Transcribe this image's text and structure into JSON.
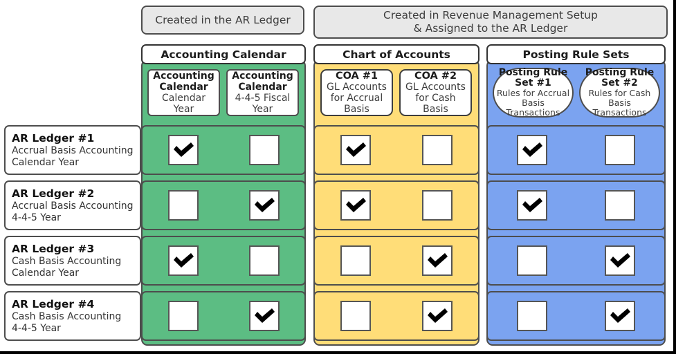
{
  "banners": [
    {
      "id": "created-ar-ledger",
      "text": "Created in the AR Ledger"
    },
    {
      "id": "created-rev-mgmt",
      "text": "Created in Revenue Management Setup\n& Assigned to the AR Ledger"
    }
  ],
  "columns": [
    {
      "id": "accounting-calendar",
      "header": "Accounting Calendar",
      "color": "#5cbd83",
      "cards": [
        {
          "title": "Accounting\nCalendar",
          "subtitle": "Calendar Year"
        },
        {
          "title": "Accounting\nCalendar",
          "subtitle": "4-4-5 Fiscal\nYear"
        }
      ]
    },
    {
      "id": "chart-of-accounts",
      "header": "Chart of Accounts",
      "color": "#ffdd78",
      "cards": [
        {
          "title": "COA #1",
          "subtitle": "GL Accounts\nfor Accrual\nBasis"
        },
        {
          "title": "COA #2",
          "subtitle": "GL Accounts\nfor Cash Basis"
        }
      ]
    },
    {
      "id": "posting-rule-sets",
      "header": "Posting Rule Sets",
      "color": "#7ba3f0",
      "cards": [
        {
          "title": "Posting Rule\nSet #1",
          "subtitle": "Rules for Accrual\nBasis\nTransactions"
        },
        {
          "title": "Posting Rule\nSet #2",
          "subtitle": "Rules for Cash\nBasis\nTransactions"
        }
      ]
    }
  ],
  "rows": [
    {
      "id": "ar-ledger-1",
      "name": "AR Ledger #1",
      "description": "Accrual Basis Accounting\nCalendar Year",
      "selections": {
        "accounting-calendar": [
          true,
          false
        ],
        "chart-of-accounts": [
          true,
          false
        ],
        "posting-rule-sets": [
          true,
          false
        ]
      }
    },
    {
      "id": "ar-ledger-2",
      "name": "AR Ledger #2",
      "description": "Accrual Basis Accounting\n4-4-5 Year",
      "selections": {
        "accounting-calendar": [
          false,
          true
        ],
        "chart-of-accounts": [
          true,
          false
        ],
        "posting-rule-sets": [
          true,
          false
        ]
      }
    },
    {
      "id": "ar-ledger-3",
      "name": "AR Ledger #3",
      "description": "Cash Basis Accounting\nCalendar Year",
      "selections": {
        "accounting-calendar": [
          true,
          false
        ],
        "chart-of-accounts": [
          false,
          true
        ],
        "posting-rule-sets": [
          false,
          true
        ]
      }
    },
    {
      "id": "ar-ledger-4",
      "name": "AR Ledger #4",
      "description": "Cash Basis Accounting\n4-4-5 Year",
      "selections": {
        "accounting-calendar": [
          false,
          true
        ],
        "chart-of-accounts": [
          false,
          true
        ],
        "posting-rule-sets": [
          false,
          true
        ]
      }
    }
  ],
  "icons": {
    "checked": "check-mark-icon",
    "unchecked": "empty-checkbox-icon"
  }
}
